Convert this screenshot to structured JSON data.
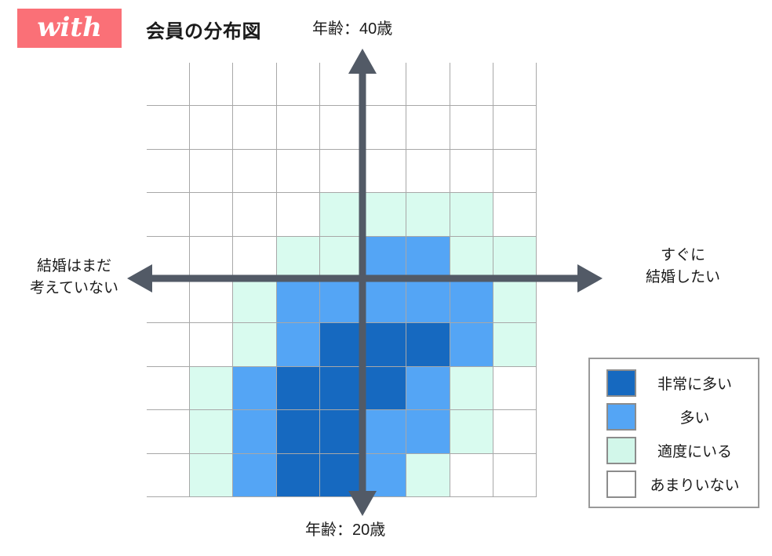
{
  "brand": {
    "wordmark": "with",
    "background_color": "#fa7077"
  },
  "header": {
    "title": "会員の分布図"
  },
  "axes": {
    "top_label": "年齢：40歳",
    "bottom_label": "年齢：20歳",
    "left_label_line1": "結婚はまだ",
    "left_label_line2": "考えていない",
    "right_label_line1": "すぐに",
    "right_label_line2": "結婚したい",
    "axis_color": "#525a66"
  },
  "legend": {
    "items": [
      {
        "label": "非常に多い",
        "color": "#1669c0",
        "level": 3
      },
      {
        "label": "多い",
        "color": "#54a5f5",
        "level": 2
      },
      {
        "label": "適度にいる",
        "color": "#d2f7ea",
        "level": 1
      },
      {
        "label": "あまりいない",
        "color": "#ffffff",
        "level": 0
      }
    ]
  },
  "chart_data": {
    "type": "heatmap",
    "title": "会員の分布図",
    "xlabel": "結婚はまだ考えていない ↔ すぐに結婚したい",
    "ylabel": "年齢：20歳 ↔ 年齢：40歳",
    "grid": true,
    "legend_position": "bottom-right",
    "columns": 9,
    "rows": 10,
    "x_axis_left_label": "結婚はまだ考えていない",
    "x_axis_right_label": "すぐに結婚したい",
    "y_axis_top_label": "年齢：40歳",
    "y_axis_bottom_label": "年齢：20歳",
    "value_scale": [
      {
        "level": 0,
        "name": "あまりいない",
        "color": "#ffffff"
      },
      {
        "level": 1,
        "name": "適度にいる",
        "color": "#d9fbef"
      },
      {
        "level": 2,
        "name": "多い",
        "color": "#54a5f5"
      },
      {
        "level": 3,
        "name": "非常に多い",
        "color": "#1669c0"
      }
    ],
    "values": [
      [
        0,
        0,
        0,
        0,
        0,
        0,
        0,
        0,
        0
      ],
      [
        0,
        0,
        0,
        0,
        0,
        0,
        0,
        0,
        0
      ],
      [
        0,
        0,
        0,
        0,
        0,
        0,
        0,
        0,
        0
      ],
      [
        0,
        0,
        0,
        0,
        1,
        1,
        1,
        1,
        0
      ],
      [
        0,
        0,
        0,
        1,
        1,
        2,
        2,
        1,
        1
      ],
      [
        0,
        0,
        1,
        2,
        2,
        2,
        2,
        2,
        1
      ],
      [
        0,
        0,
        1,
        2,
        3,
        3,
        3,
        2,
        1
      ],
      [
        0,
        1,
        2,
        3,
        3,
        3,
        2,
        1,
        0
      ],
      [
        0,
        1,
        2,
        3,
        3,
        2,
        2,
        1,
        0
      ],
      [
        0,
        1,
        2,
        3,
        3,
        2,
        1,
        0,
        0
      ]
    ]
  }
}
